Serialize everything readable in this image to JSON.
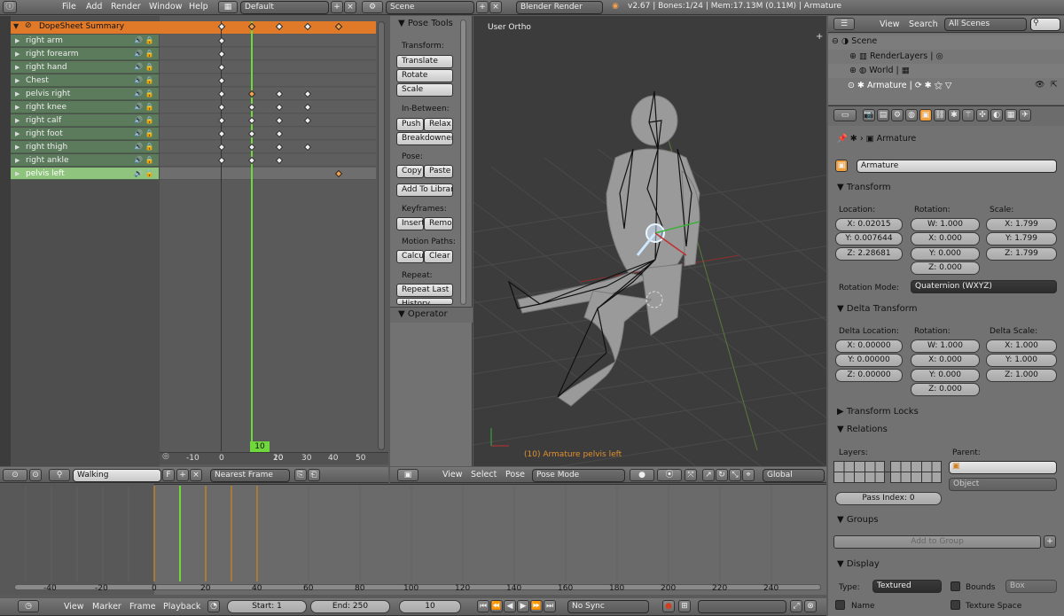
{
  "top_bar": {
    "menus": [
      "File",
      "Add",
      "Render",
      "Window",
      "Help"
    ],
    "layout": "Default",
    "scene": "Scene",
    "engine": "Blender Render",
    "status": "v2.67 | Bones:1/24 | Mem:17.13M (0.11M) | Armature"
  },
  "dopesheet": {
    "summary_label": "DopeSheet Summary",
    "channels": [
      "right arm",
      "right forearm",
      "right hand",
      "Chest",
      "pelvis right",
      "right knee",
      "right calf",
      "right foot",
      "right thigh",
      "right ankle",
      "pelvis left"
    ],
    "ruler_ticks": [
      "-10",
      "0",
      "10",
      "20",
      "30",
      "40",
      "50"
    ],
    "current_frame": "10",
    "footer": {
      "action": "Walking",
      "f_label": "F",
      "snap": "Nearest Frame"
    }
  },
  "tools": {
    "panel_title": "Pose Tools",
    "transform_label": "Transform:",
    "translate": "Translate",
    "rotate": "Rotate",
    "scale": "Scale",
    "inbetween_label": "In-Between:",
    "push": "Push",
    "relax": "Relax",
    "breakdowner": "Breakdowner",
    "pose_label": "Pose:",
    "copy": "Copy",
    "paste": "Paste",
    "add_to_library": "Add To Librar",
    "keyframes_label": "Keyframes:",
    "insert": "Insert",
    "remove": "Remo",
    "motion_label": "Motion Paths:",
    "calculate": "Calcu",
    "clear": "Clear",
    "repeat_label": "Repeat:",
    "repeat_last": "Repeat Last",
    "history": "History",
    "operator_title": "Operator"
  },
  "viewport": {
    "view_label": "User Ortho",
    "status_text": "(10) Armature pelvis left",
    "menus": [
      "View",
      "Select",
      "Pose"
    ],
    "mode": "Pose Mode",
    "orientation": "Global"
  },
  "timeline": {
    "ticks": [
      "-40",
      "-20",
      "0",
      "20",
      "40",
      "60",
      "80",
      "100",
      "120",
      "140",
      "160",
      "180",
      "200",
      "220",
      "240"
    ],
    "menus": [
      "View",
      "Marker",
      "Frame",
      "Playback"
    ],
    "start": "Start: 1",
    "end": "End: 250",
    "current": "10",
    "sync": "No Sync"
  },
  "outliner": {
    "menus": [
      "View",
      "Search"
    ],
    "scenes": "All Scenes",
    "items": [
      "Scene",
      "RenderLayers",
      "World",
      "Armature"
    ]
  },
  "properties": {
    "context": "Armature",
    "object_name": "Armature",
    "transform_title": "Transform",
    "location_label": "Location:",
    "rotation_label": "Rotation:",
    "scale_label": "Scale:",
    "location": [
      "X: 0.02015",
      "Y: 0.007644",
      "Z: 2.28681"
    ],
    "rotation": [
      "W: 1.000",
      "X: 0.000",
      "Y: 0.000",
      "Z: 0.000"
    ],
    "scale": [
      "X: 1.799",
      "Y: 1.799",
      "Z: 1.799"
    ],
    "rotation_mode_label": "Rotation Mode:",
    "rotation_mode": "Quaternion (WXYZ)",
    "delta_title": "Delta Transform",
    "delta_location_label": "Delta Location:",
    "delta_rotation_label": "Rotation:",
    "delta_scale_label": "Delta Scale:",
    "delta_location": [
      "X: 0.00000",
      "Y: 0.00000",
      "Z: 0.00000"
    ],
    "delta_rotation": [
      "W: 1.000",
      "X: 0.000",
      "Y: 0.000",
      "Z: 0.000"
    ],
    "delta_scale": [
      "X: 1.000",
      "Y: 1.000",
      "Z: 1.000"
    ],
    "locks_title": "Transform Locks",
    "relations_title": "Relations",
    "layers_label": "Layers:",
    "parent_label": "Parent:",
    "parent_type": "Object",
    "pass_index": "Pass Index: 0",
    "groups_title": "Groups",
    "add_group": "Add to Group",
    "display_title": "Display",
    "type_label": "Type:",
    "display_type": "Textured",
    "bounds": "Bounds",
    "bounds_type": "Box",
    "name": "Name",
    "texture_space": "Texture Space"
  }
}
